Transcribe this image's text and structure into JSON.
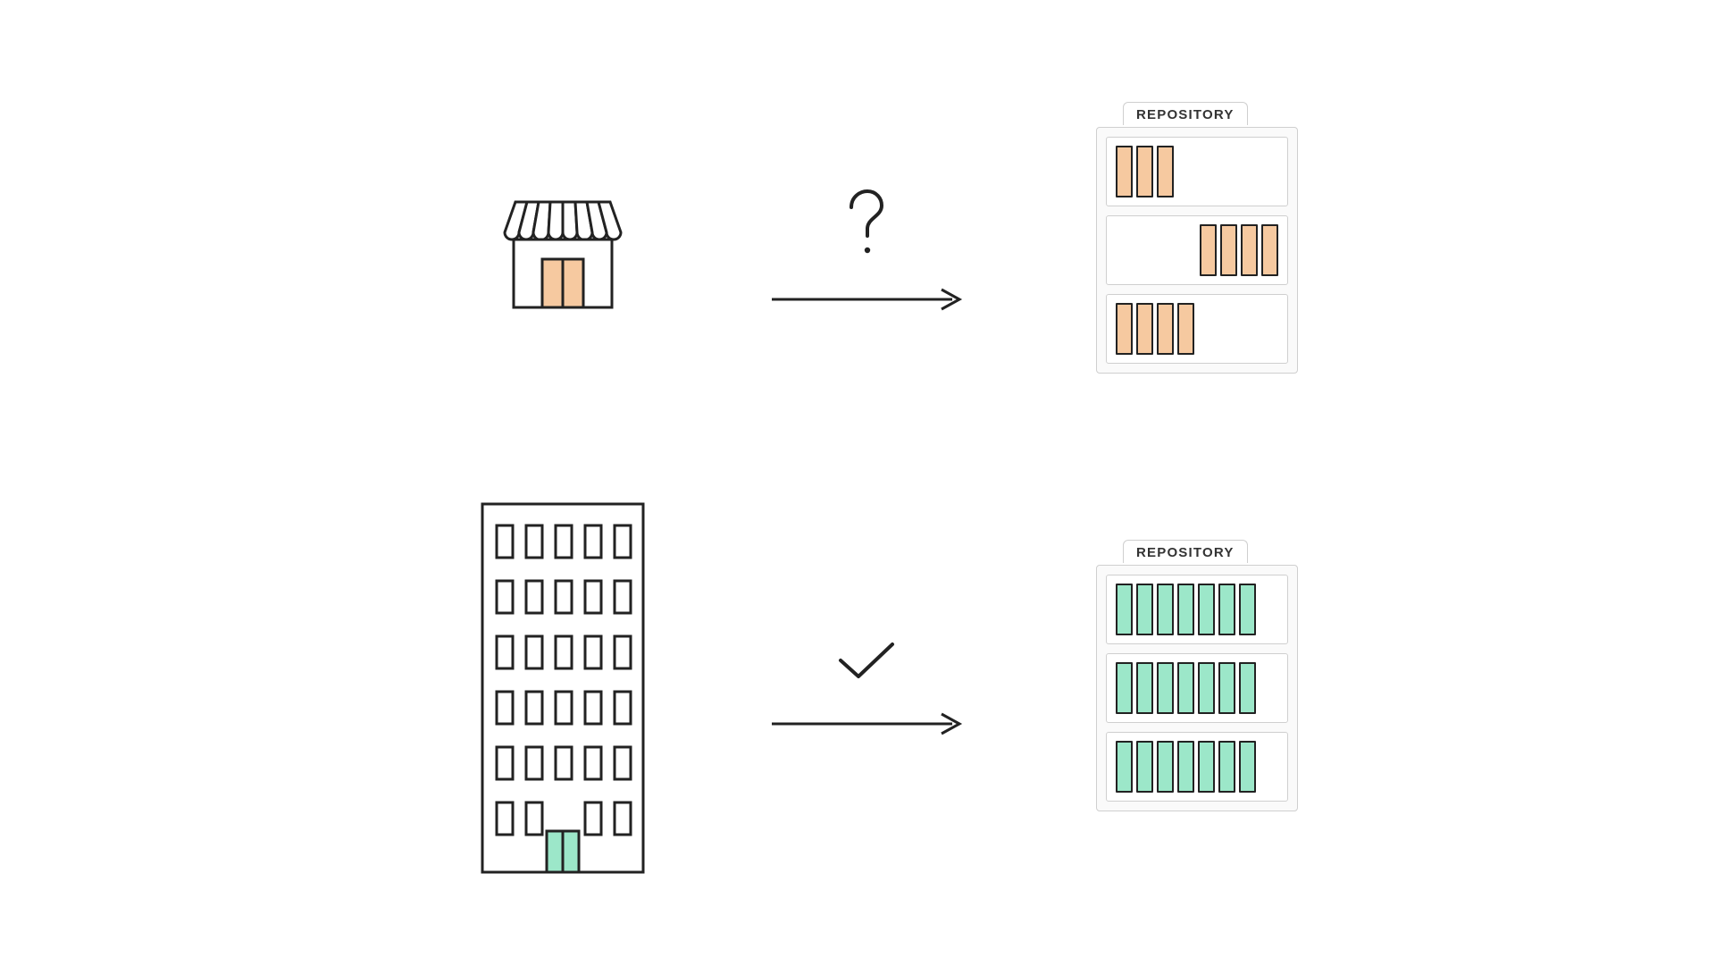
{
  "diagram": {
    "top": {
      "entity_icon": "small-shop",
      "symbol": "question-mark",
      "repository": {
        "label": "REPOSITORY",
        "shelves": [
          {
            "count": 3,
            "align": "left",
            "color": "orange"
          },
          {
            "count": 4,
            "align": "right",
            "color": "orange"
          },
          {
            "count": 4,
            "align": "left",
            "color": "orange"
          }
        ]
      }
    },
    "bottom": {
      "entity_icon": "office-building",
      "symbol": "check-mark",
      "repository": {
        "label": "REPOSITORY",
        "shelves": [
          {
            "count": 7,
            "align": "left",
            "color": "green"
          },
          {
            "count": 7,
            "align": "left",
            "color": "green"
          },
          {
            "count": 7,
            "align": "left",
            "color": "green"
          }
        ]
      }
    }
  },
  "colors": {
    "orange": "#f6c9a0",
    "green": "#9ce7c9",
    "stroke": "#222222",
    "light_border": "#cfcfcf"
  }
}
